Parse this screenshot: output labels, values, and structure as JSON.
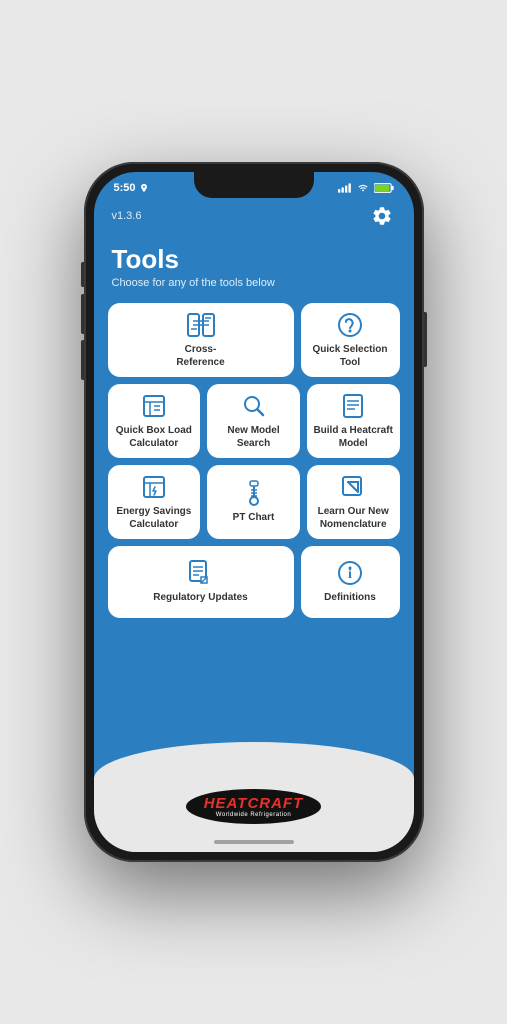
{
  "status": {
    "time": "5:50",
    "version": "v1.3.6"
  },
  "header": {
    "title": "Tools",
    "subtitle": "Choose for any of the tools below"
  },
  "tools": [
    {
      "id": "cross-reference",
      "label": "Cross-Reference",
      "icon": "cross-ref",
      "row": 0,
      "wide": true
    },
    {
      "id": "quick-selection",
      "label": "Quick Selection Tool",
      "icon": "hand-cursor",
      "row": 0,
      "wide": false
    },
    {
      "id": "quick-box",
      "label": "Quick Box Load Calculator",
      "icon": "calculator",
      "row": 1,
      "wide": false
    },
    {
      "id": "model-search",
      "label": "New Model Search",
      "icon": "magnifier",
      "row": 1,
      "wide": false
    },
    {
      "id": "build-model",
      "label": "Build a Heatcraft Model",
      "icon": "book",
      "row": 1,
      "wide": false
    },
    {
      "id": "energy-savings",
      "label": "Energy Savings Calculator",
      "icon": "energy-calc",
      "row": 2,
      "wide": false
    },
    {
      "id": "pt-chart",
      "label": "PT Chart",
      "icon": "thermometer",
      "row": 2,
      "wide": false
    },
    {
      "id": "nomenclature",
      "label": "Learn Our New Nomenclature",
      "icon": "arrow-corner",
      "row": 2,
      "wide": false
    },
    {
      "id": "regulatory",
      "label": "Regulatory Updates",
      "icon": "document-edit",
      "row": 3,
      "wide": true
    },
    {
      "id": "definitions",
      "label": "Definitions",
      "icon": "info-circle",
      "row": 3,
      "wide": false
    }
  ],
  "logo": {
    "brand": "HEATCRAFT",
    "subtitle": "Worldwide Refrigeration"
  }
}
